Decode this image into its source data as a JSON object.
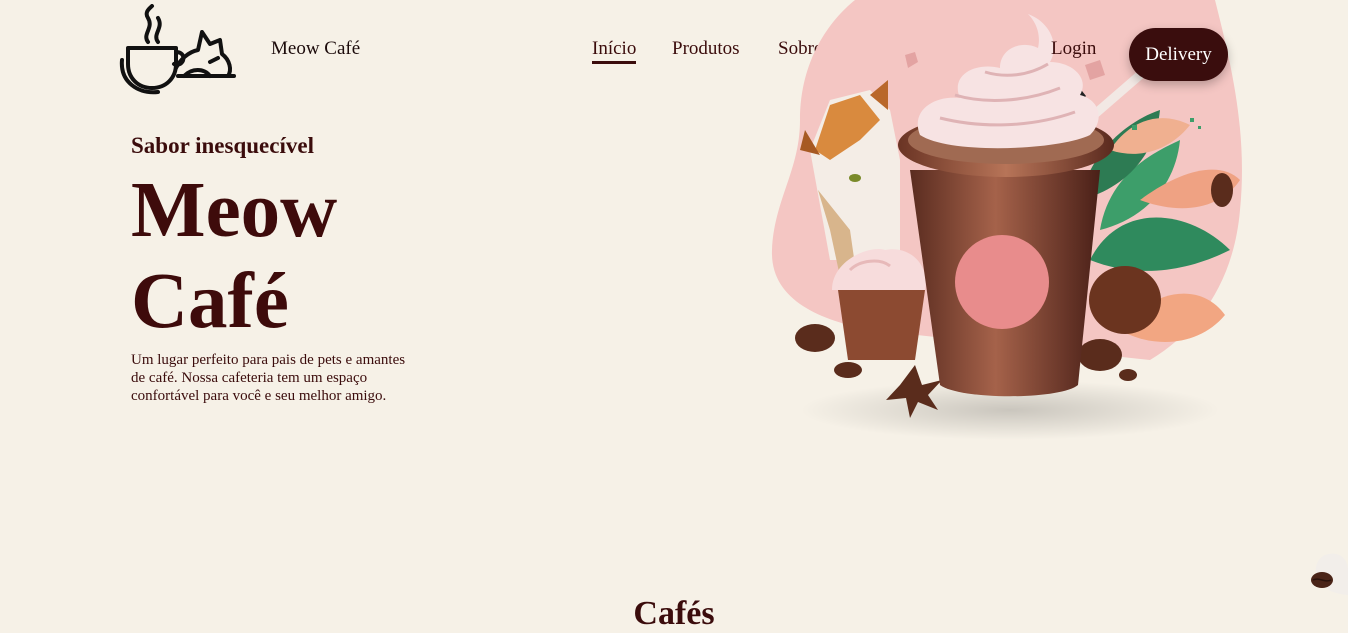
{
  "header": {
    "brand": "Meow Café",
    "nav": [
      {
        "label": "Início",
        "active": true
      },
      {
        "label": "Produtos",
        "active": false
      },
      {
        "label": "Sobre",
        "active": false
      }
    ],
    "login": "Login",
    "delivery": "Delivery"
  },
  "hero": {
    "eyebrow": "Sabor inesquecível",
    "title_line1": "Meow",
    "title_line2": "Café",
    "description": "Um lugar perfeito para pais de pets e amantes de café. Nossa cafeteria tem um espaço confortável para você e seu melhor amigo."
  },
  "section": {
    "title": "Cafés"
  },
  "colors": {
    "background": "#f6f1e7",
    "primary": "#3b0c0c",
    "button": "#3a0d0d",
    "accent_pink": "#f4c4c4"
  },
  "icons": {
    "logo": "cat-coffee-cup-icon",
    "hero": "frappe-with-cat-illustration",
    "float": "coffee-bean-icon"
  }
}
